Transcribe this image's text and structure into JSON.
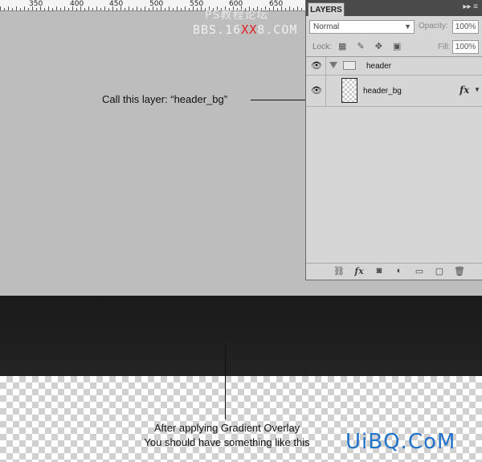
{
  "ruler": {
    "labels": [
      "350",
      "400",
      "450",
      "500",
      "550",
      "600",
      "650"
    ]
  },
  "watermark": {
    "line1": "PS教程论坛",
    "line2_part1": "BBS.16",
    "line2_red": "XX",
    "line2_part2": "8.COM"
  },
  "annotations": {
    "call_layer": "Call this layer: “header_bg”",
    "after_line1": "After applying Gradient Overlay",
    "after_line2": "You should have something like this"
  },
  "logo": {
    "text": "UiBQ.CoM",
    "color": "#2273c9"
  },
  "layers_panel": {
    "tab_label": "LAYERS",
    "menu_arrows": "▸▸ ≡",
    "blend_mode": "Normal",
    "opacity_label": "Opacity:",
    "opacity_value": "100%",
    "lock_label": "Lock:",
    "lock_icons": "▦ ✎ ✥ ▣",
    "fill_label": "Fill:",
    "fill_value": "100%",
    "layers": [
      {
        "name": "header",
        "type": "group",
        "visible": true
      },
      {
        "name": "header_bg",
        "type": "layer",
        "visible": true,
        "has_effects": true
      }
    ],
    "fx_label": "fx",
    "footer_icons": [
      "link-icon",
      "fx-icon",
      "mask-icon",
      "adjustment-icon",
      "folder-icon",
      "new-layer-icon",
      "trash-icon"
    ],
    "footer_glyphs": [
      "⛓",
      "fx",
      "◙",
      "◐",
      "▭",
      "▢",
      "🗑"
    ]
  },
  "colors": {
    "canvas_gray": "#bdbdbd",
    "dark_band": "#1e1e1e",
    "accent_red": "#e02020"
  }
}
